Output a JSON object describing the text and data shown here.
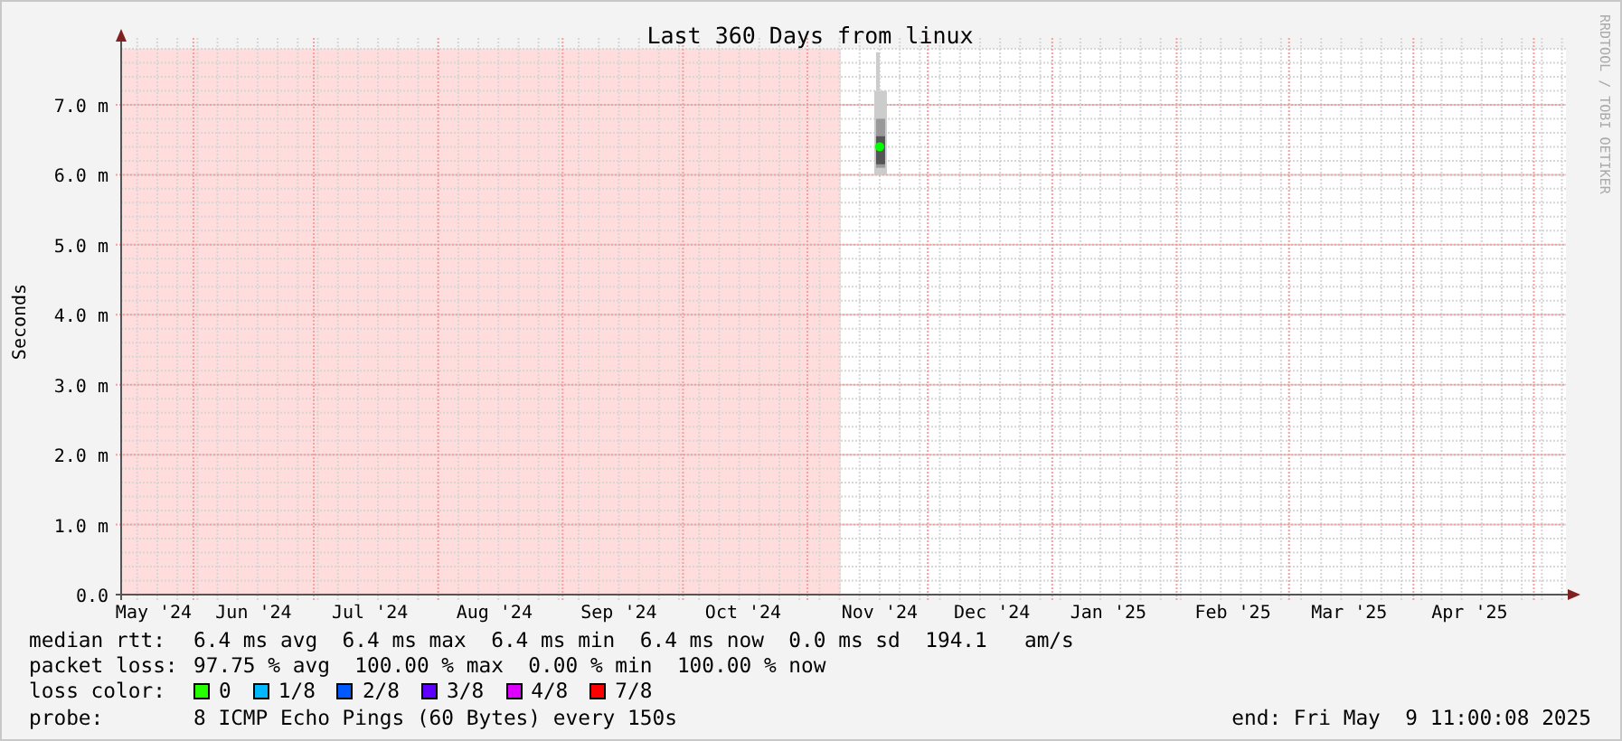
{
  "graph": {
    "side_credit": "RRDTOOL / TOBI OETIKER",
    "chart_data": {
      "type": "line",
      "title": "Last 360 Days from linux",
      "ylabel": "Seconds",
      "categories": [
        "May '24",
        "Jun '24",
        "Jul '24",
        "Aug '24",
        "Sep '24",
        "Oct '24",
        "Nov '24",
        "Dec '24",
        "Jan '25",
        "Feb '25",
        "Mar '25",
        "Apr '25"
      ],
      "series": [
        {
          "color": "#00ff00",
          "marker": "circle",
          "values": [
            null,
            null,
            null,
            null,
            null,
            null,
            6.4,
            null,
            null,
            null,
            null,
            null
          ]
        }
      ],
      "ylim": [
        0,
        7.8
      ],
      "yticks": [
        {
          "value": 0,
          "label": "0.0"
        },
        {
          "value": 1,
          "label": "1.0 m"
        },
        {
          "value": 2,
          "label": "2.0 m"
        },
        {
          "value": 3,
          "label": "3.0 m"
        },
        {
          "value": 4,
          "label": "4.0 m"
        },
        {
          "value": 5,
          "label": "5.0 m"
        },
        {
          "value": 6,
          "label": "6.0 m"
        },
        {
          "value": 7,
          "label": "7.0 m"
        }
      ],
      "grid": true
    }
  },
  "legend": {
    "median_rtt": {
      "label": "median rtt:",
      "text": "6.4 ms avg  6.4 ms max  6.4 ms min  6.4 ms now  0.0 ms sd  194.1   am/s"
    },
    "packet_loss": {
      "label": "packet loss:",
      "text": "97.75 % avg  100.00 % max  0.00 % min  100.00 % now"
    },
    "loss_color": {
      "label": "loss color:",
      "items": [
        {
          "label": "0",
          "color": "#26ff00"
        },
        {
          "label": "1/8",
          "color": "#00b8ff"
        },
        {
          "label": "2/8",
          "color": "#0059ff"
        },
        {
          "label": "3/8",
          "color": "#5e00ff"
        },
        {
          "label": "4/8",
          "color": "#dd00ff"
        },
        {
          "label": "7/8",
          "color": "#ff0000"
        }
      ]
    },
    "probe": {
      "label": "probe:",
      "text": "8 ICMP Echo Pings (60 Bytes) every 150s"
    },
    "end": "end: Fri May  9 11:00:08 2025"
  }
}
